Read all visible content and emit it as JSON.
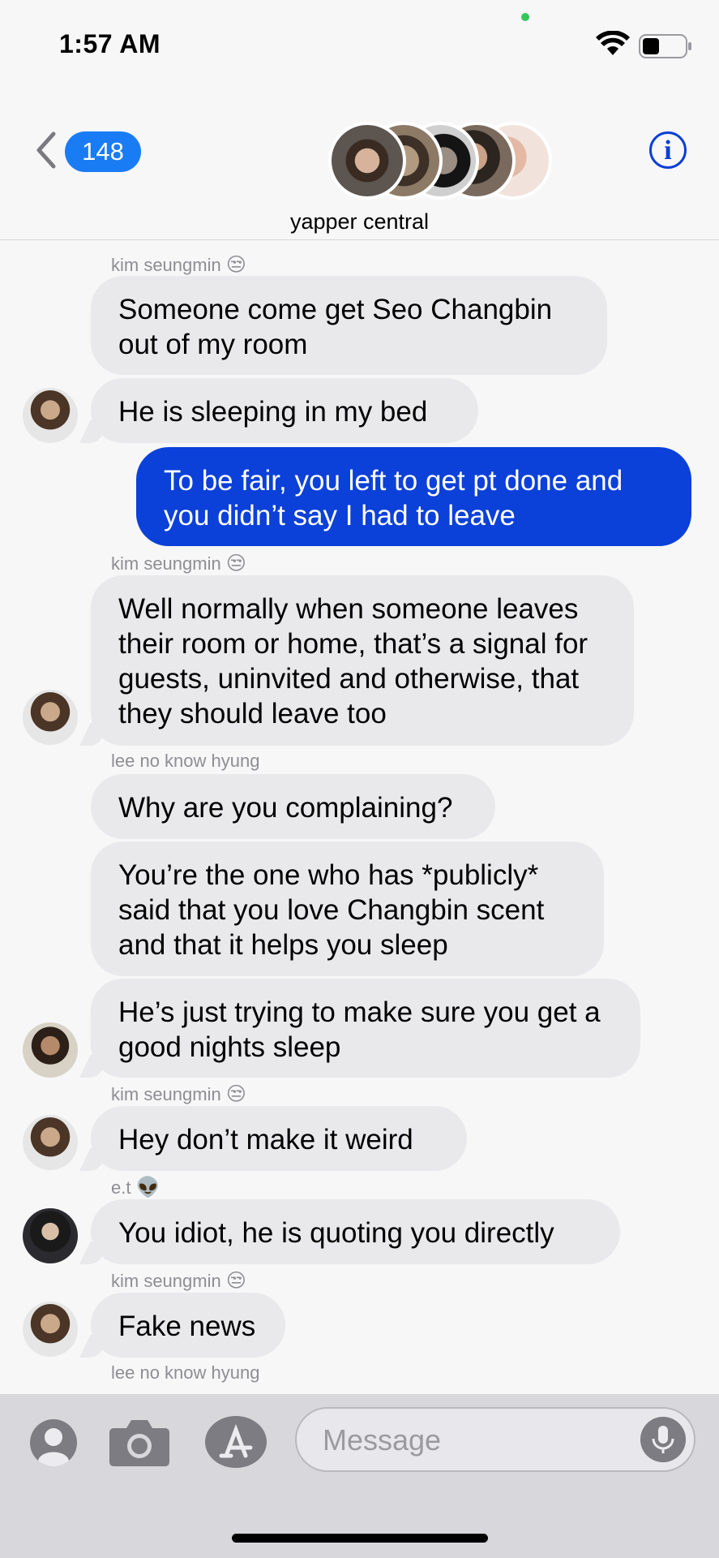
{
  "status_bar": {
    "time": "1:57 AM"
  },
  "header": {
    "back_count": "148",
    "group_name": "yapper central",
    "info_label": "i"
  },
  "messages": [
    {
      "sender": "kim seungmin",
      "sender_emoji": "😒",
      "text": "Someone come get Seo Changbin out of my room"
    },
    {
      "text": "He is sleeping in my bed"
    },
    {
      "outgoing": true,
      "text": "To be fair, you left to get pt done and you didn’t say I had to leave"
    },
    {
      "sender": "kim seungmin",
      "sender_emoji": "😒",
      "text": "Well normally when someone leaves their room or home, that’s a signal for guests, uninvited and otherwise, that they should leave too"
    },
    {
      "sender": "lee no know hyung",
      "text": "Why are you complaining?"
    },
    {
      "text": "You’re the one who has *publicly* said that you love Changbin scent and that it helps you sleep"
    },
    {
      "text": "He’s just trying to make sure you get a good nights sleep"
    },
    {
      "sender": "kim seungmin",
      "sender_emoji": "😒",
      "text": "Hey don’t make it weird"
    },
    {
      "sender": "e.t",
      "sender_emoji": "👽",
      "text": "You idiot, he is quoting you directly"
    },
    {
      "sender": "kim seungmin",
      "sender_emoji": "😒",
      "text": "Fake news"
    },
    {
      "sender": "lee no know hyung"
    }
  ],
  "input": {
    "placeholder": "Message"
  },
  "icons": [
    "contacts-icon",
    "camera-icon",
    "app-store-icon",
    "microphone-icon",
    "wifi-icon",
    "battery-icon",
    "back-chevron-icon",
    "info-icon"
  ]
}
